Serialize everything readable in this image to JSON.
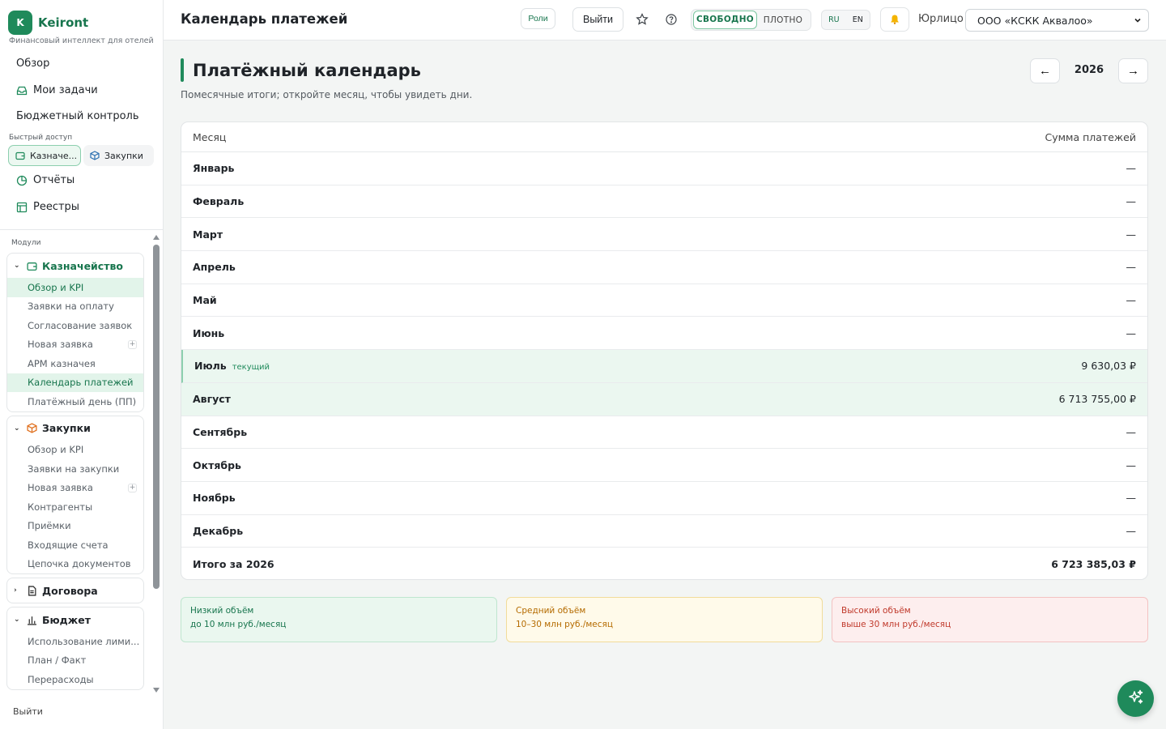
{
  "sidebar": {
    "brand_letter": "K",
    "brand_name": "Keiront",
    "brand_sub": "Финансовый интеллект для отелей",
    "nav": {
      "overview": "Обзор",
      "tasks": "Мои задачи",
      "budget_control": "Бюджетный контроль",
      "reports": "Отчёты",
      "registries": "Реестры"
    },
    "quick_access_label": "Быстрый доступ",
    "quick_access": [
      "Казначе...",
      "Закупки"
    ],
    "modules_label": "Модули",
    "groups": [
      {
        "label": "Казначейство",
        "items": [
          "Обзор и KPI",
          "Заявки на оплату",
          "Согласование заявок",
          "Новая заявка",
          "АРМ казначея",
          "Календарь платежей",
          "Платёжный день (ПП)"
        ]
      },
      {
        "label": "Закупки",
        "items": [
          "Обзор и KPI",
          "Заявки на закупки",
          "Новая заявка",
          "Контрагенты",
          "Приёмки",
          "Входящие счета",
          "Цепочка документов"
        ]
      },
      {
        "label": "Договора",
        "items": []
      },
      {
        "label": "Бюджет",
        "items": [
          "Использование лими...",
          "План / Факт",
          "Перерасходы"
        ]
      }
    ],
    "plus": "+",
    "logout": "Выйти"
  },
  "header": {
    "title": "Календарь платежей",
    "roles": "Роли",
    "exit": "Выйти",
    "density_on": "СВОБОДНО",
    "density_off": "ПЛОТНО",
    "lang_ru": "RU",
    "lang_en": "EN",
    "entity_label": "Юрлицо",
    "entity_value": "ООО «КСКК Аквалоо»"
  },
  "main": {
    "title": "Платёжный календарь",
    "subtitle": "Помесячные итоги; откройте месяц, чтобы увидеть дни.",
    "prev": "←",
    "next": "→",
    "year": "2026",
    "table": {
      "col_month": "Месяц",
      "col_sum": "Сумма платежей",
      "current_badge": "текущий",
      "rows": [
        {
          "month": "Январь",
          "sum": "—"
        },
        {
          "month": "Февраль",
          "sum": "—"
        },
        {
          "month": "Март",
          "sum": "—"
        },
        {
          "month": "Апрель",
          "sum": "—"
        },
        {
          "month": "Май",
          "sum": "—"
        },
        {
          "month": "Июнь",
          "sum": "—"
        },
        {
          "month": "Июль",
          "sum": "9 630,03 ₽"
        },
        {
          "month": "Август",
          "sum": "6 713 755,00 ₽"
        },
        {
          "month": "Сентябрь",
          "sum": "—"
        },
        {
          "month": "Октябрь",
          "sum": "—"
        },
        {
          "month": "Ноябрь",
          "sum": "—"
        },
        {
          "month": "Декабрь",
          "sum": "—"
        }
      ],
      "total_label": "Итого за 2026",
      "total_value": "6 723 385,03 ₽"
    },
    "legend": {
      "low_title": "Низкий объём",
      "low_desc": "до 10 млн руб./месяц",
      "mid_title": "Средний объём",
      "mid_desc": "10–30 млн руб./месяц",
      "high_title": "Высокий объём",
      "high_desc": "выше 30 млн руб./месяц"
    }
  },
  "colors": {
    "accent": "#1f8a5b",
    "low": "#17754d",
    "mid": "#b56b00",
    "high": "#c0392b"
  }
}
